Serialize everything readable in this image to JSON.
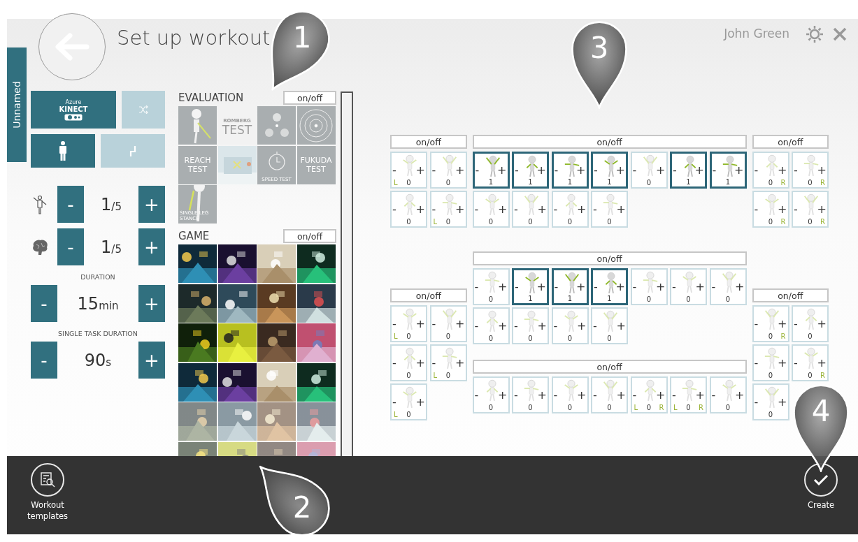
{
  "header": {
    "title": "Set up workout",
    "user": "John Green"
  },
  "profile_tab": {
    "label": "Unnamed"
  },
  "device_buttons": [
    {
      "kind": "sensor",
      "caption": "Azure",
      "label": "KINECT",
      "selected": true
    },
    {
      "kind": "shuffle",
      "selected": false
    }
  ],
  "posture_buttons": [
    {
      "kind": "standing",
      "selected": true
    },
    {
      "kind": "sitting",
      "selected": false
    }
  ],
  "counters": [
    {
      "kind": "motor",
      "decrease": "-",
      "value": "1$_{/5}$",
      "increase": "+"
    },
    {
      "kind": "cognitive",
      "decrease": "-",
      "value": "1$_{/5}$",
      "increase": "+"
    },
    {
      "kind": "plain",
      "title": "DURATION",
      "decrease": "-",
      "value": "15$_{min}$",
      "increase": "+"
    },
    {
      "kind": "plain",
      "title": "SINGLE TASK DURATION",
      "decrease": "-",
      "value": "90$_{s}$",
      "increase": "+"
    }
  ],
  "library": [
    {
      "title": "EVALUATION",
      "toggle": "on/off",
      "items": [
        {
          "kind": "figure"
        },
        {
          "kind": "text",
          "caption": "ROMBERG",
          "label": "TEST"
        },
        {
          "kind": "dots"
        },
        {
          "kind": "target"
        },
        {
          "kind": "text",
          "label": "REACH TEST"
        },
        {
          "kind": "picture"
        },
        {
          "kind": "timer",
          "label": "SPEED TEST"
        },
        {
          "kind": "text",
          "label": "FUKUDA TEST"
        },
        {
          "kind": "leg",
          "label": "SINGLE LEG STANCE"
        }
      ]
    },
    {
      "title": "GAME",
      "toggle": "on/off",
      "items": [
        {
          "kind": "picture"
        },
        {
          "kind": "picture"
        },
        {
          "kind": "picture"
        },
        {
          "kind": "picture"
        },
        {
          "kind": "picture"
        },
        {
          "kind": "picture"
        },
        {
          "kind": "picture"
        },
        {
          "kind": "picture"
        },
        {
          "kind": "picture"
        },
        {
          "kind": "picture"
        },
        {
          "kind": "picture"
        },
        {
          "kind": "picture"
        },
        {
          "kind": "picture"
        },
        {
          "kind": "picture"
        },
        {
          "kind": "picture"
        },
        {
          "kind": "picture"
        },
        {
          "kind": "picture"
        },
        {
          "kind": "picture"
        },
        {
          "kind": "picture"
        },
        {
          "kind": "picture"
        },
        {
          "kind": "picture"
        },
        {
          "kind": "picture"
        },
        {
          "kind": "picture"
        },
        {
          "kind": "picture"
        }
      ]
    }
  ],
  "exercise_groups": [
    {
      "toggle": "on/off",
      "tiles": [
        {
          "minus": "-",
          "plus": "+",
          "count": "0",
          "selected": false,
          "side_left": "L"
        },
        {
          "minus": "-",
          "plus": "+",
          "count": "0",
          "selected": false
        },
        {
          "minus": "-",
          "plus": "+",
          "count": "0",
          "selected": false
        },
        {
          "minus": "-",
          "plus": "+",
          "count": "0",
          "selected": false,
          "side_left": "L"
        }
      ]
    },
    {
      "toggle": "on/off",
      "tiles": [
        {
          "minus": "-",
          "plus": "+",
          "count": "1",
          "selected": true
        },
        {
          "minus": "-",
          "plus": "+",
          "count": "1",
          "selected": true
        },
        {
          "minus": "-",
          "plus": "+",
          "count": "1",
          "selected": true
        },
        {
          "minus": "-",
          "plus": "+",
          "count": "1",
          "selected": true
        },
        {
          "minus": "-",
          "plus": "+",
          "count": "0",
          "selected": false
        },
        {
          "minus": "-",
          "plus": "+",
          "count": "1",
          "selected": true
        },
        {
          "minus": "-",
          "plus": "+",
          "count": "1",
          "selected": true
        },
        {
          "minus": "-",
          "plus": "+",
          "count": "0",
          "selected": false
        },
        {
          "minus": "-",
          "plus": "+",
          "count": "0",
          "selected": false
        },
        {
          "minus": "-",
          "plus": "+",
          "count": "0",
          "selected": false
        },
        {
          "minus": "-",
          "plus": "+",
          "count": "0",
          "selected": false
        }
      ]
    },
    {
      "toggle": "on/off",
      "tiles": [
        {
          "minus": "-",
          "plus": "+",
          "count": "0",
          "selected": false,
          "side_right": "R"
        },
        {
          "minus": "-",
          "plus": "+",
          "count": "0",
          "selected": false,
          "side_right": "R"
        },
        {
          "minus": "-",
          "plus": "+",
          "count": "0",
          "selected": false,
          "side_right": "R"
        },
        {
          "minus": "-",
          "plus": "+",
          "count": "0",
          "selected": false,
          "side_right": "R"
        }
      ]
    },
    {
      "toggle": "on/off",
      "tiles": [
        {
          "minus": "-",
          "plus": "+",
          "count": "0",
          "selected": false
        },
        {
          "minus": "-",
          "plus": "+",
          "count": "1",
          "selected": true
        },
        {
          "minus": "-",
          "plus": "+",
          "count": "1",
          "selected": true
        },
        {
          "minus": "-",
          "plus": "+",
          "count": "1",
          "selected": true
        },
        {
          "minus": "-",
          "plus": "+",
          "count": "0",
          "selected": false
        },
        {
          "minus": "-",
          "plus": "+",
          "count": "0",
          "selected": false
        },
        {
          "minus": "-",
          "plus": "+",
          "count": "0",
          "selected": false
        },
        {
          "minus": "-",
          "plus": "+",
          "count": "0",
          "selected": false
        },
        {
          "minus": "-",
          "plus": "+",
          "count": "0",
          "selected": false
        },
        {
          "minus": "-",
          "plus": "+",
          "count": "0",
          "selected": false
        },
        {
          "minus": "-",
          "plus": "+",
          "count": "0",
          "selected": false
        }
      ]
    },
    {
      "toggle": "on/off",
      "tiles": [
        {
          "minus": "-",
          "plus": "+",
          "count": "0",
          "selected": false,
          "side_left": "L"
        },
        {
          "minus": "-",
          "plus": "+",
          "count": "0",
          "selected": false
        },
        {
          "minus": "-",
          "plus": "+",
          "count": "0",
          "selected": false
        },
        {
          "minus": "-",
          "plus": "+",
          "count": "0",
          "selected": false,
          "side_left": "L"
        },
        {
          "minus": "-",
          "plus": "+",
          "count": "0",
          "selected": false,
          "side_left": "L"
        }
      ]
    },
    {
      "toggle": "on/off",
      "tiles": [
        {
          "minus": "-",
          "plus": "+",
          "count": "0",
          "selected": false,
          "side_right": "R"
        },
        {
          "minus": "-",
          "plus": "+",
          "count": "0",
          "selected": false
        },
        {
          "minus": "-",
          "plus": "+",
          "count": "0",
          "selected": false
        },
        {
          "minus": "-",
          "plus": "+",
          "count": "0",
          "selected": false,
          "side_right": "R"
        },
        {
          "minus": "-",
          "plus": "+",
          "count": "0",
          "selected": false
        }
      ]
    },
    {
      "toggle": "on/off",
      "tiles": [
        {
          "minus": "-",
          "plus": "+",
          "count": "0",
          "selected": false
        },
        {
          "minus": "-",
          "plus": "+",
          "count": "0",
          "selected": false
        },
        {
          "minus": "-",
          "plus": "+",
          "count": "0",
          "selected": false
        },
        {
          "minus": "-",
          "plus": "+",
          "count": "0",
          "selected": false
        },
        {
          "minus": "-",
          "plus": "+",
          "count": "0",
          "selected": false,
          "side_left": "L",
          "side_right": "R"
        },
        {
          "minus": "-",
          "plus": "+",
          "count": "0",
          "selected": false,
          "side_left": "L",
          "side_right": "R"
        },
        {
          "minus": "-",
          "plus": "+",
          "count": "0",
          "selected": false
        }
      ]
    }
  ],
  "bottom_bar": {
    "actions": [
      {
        "kind": "templates",
        "label": "Workout templates"
      },
      {
        "kind": "create",
        "label": "Create"
      }
    ]
  },
  "callouts": [
    {
      "number": "1"
    },
    {
      "number": "2"
    },
    {
      "number": "3"
    },
    {
      "number": "4"
    }
  ]
}
